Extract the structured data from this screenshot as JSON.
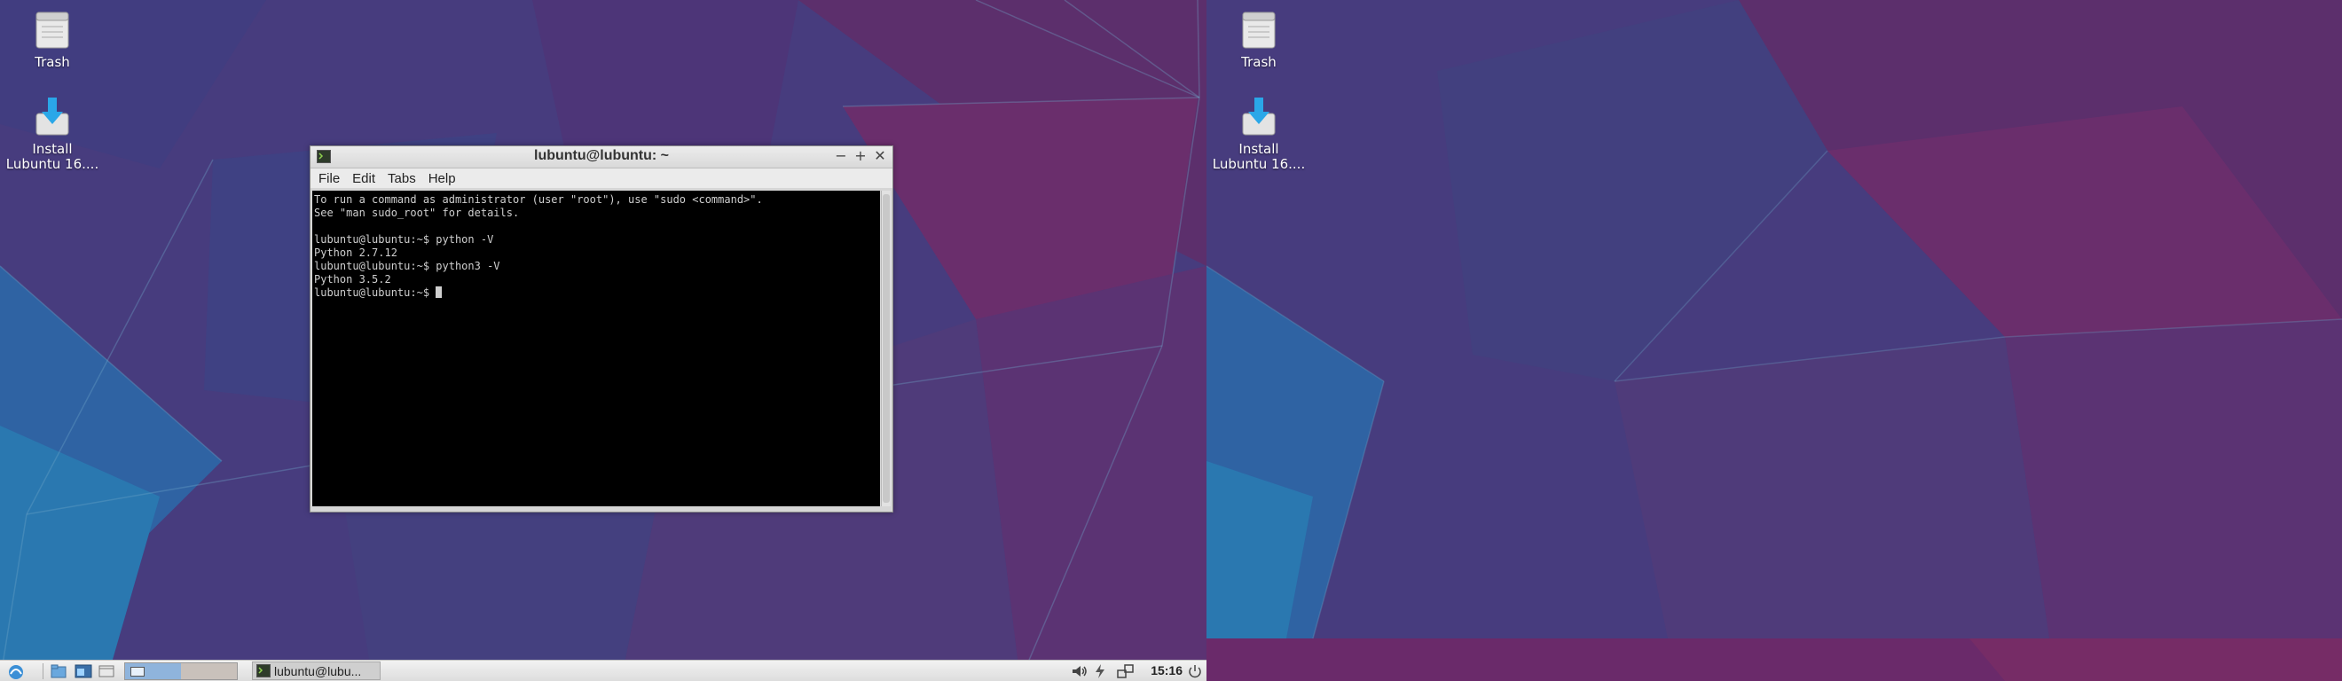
{
  "desktop": {
    "left_icons": [
      {
        "label": "Trash",
        "icon": "trash-icon"
      },
      {
        "label": "Install\nLubuntu 16....",
        "icon": "install-icon"
      }
    ],
    "right_icons": [
      {
        "label": "Trash",
        "icon": "trash-icon"
      },
      {
        "label": "Install\nLubuntu 16....",
        "icon": "install-icon"
      }
    ]
  },
  "terminal": {
    "title": "lubuntu@lubuntu: ~",
    "menu": [
      "File",
      "Edit",
      "Tabs",
      "Help"
    ],
    "lines": [
      "To run a command as administrator (user \"root\"), use \"sudo <command>\".",
      "See \"man sudo_root\" for details.",
      "",
      "lubuntu@lubuntu:~$ python -V",
      "Python 2.7.12",
      "lubuntu@lubuntu:~$ python3 -V",
      "Python 3.5.2"
    ],
    "prompt": "lubuntu@lubuntu:~$ "
  },
  "panel": {
    "task_label": "lubuntu@lubu...",
    "clock": "15:16"
  },
  "colors": {
    "wallpaper_purple": "#4a3a80",
    "wallpaper_magenta": "#6b2f6e",
    "wallpaper_blue": "#2f6aa8"
  }
}
